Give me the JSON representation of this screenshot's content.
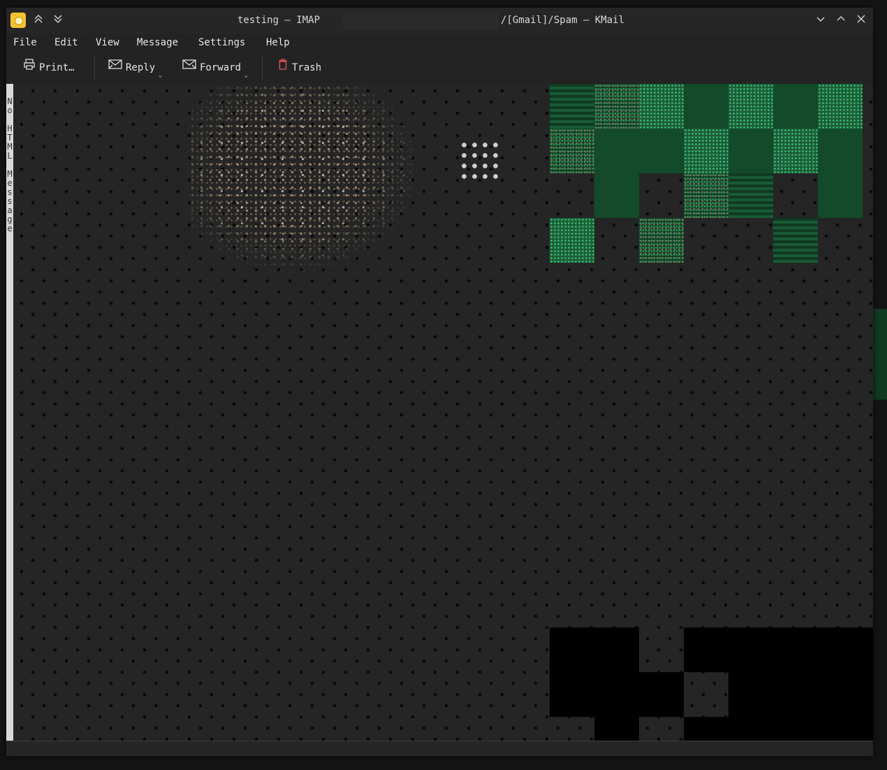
{
  "window": {
    "title_left": "testing – IMAP",
    "title_right": "/[Gmail]/Spam – KMail",
    "buttons": {
      "minimize": "﹀",
      "maximize": "︿",
      "close": "✕"
    }
  },
  "menubar": {
    "items": [
      "File",
      "Edit",
      "View",
      "Message",
      "Settings",
      "Help"
    ]
  },
  "toolbar": {
    "print": "Print…",
    "reply": "Reply",
    "forward": "Forward",
    "trash": "Trash"
  },
  "viewer": {
    "side_label": "No HTML Message"
  },
  "colors": {
    "window_bg": "#232323",
    "text": "#e6e6e6",
    "trash_icon": "#e05a5a",
    "app_icon": "#f4c430"
  }
}
